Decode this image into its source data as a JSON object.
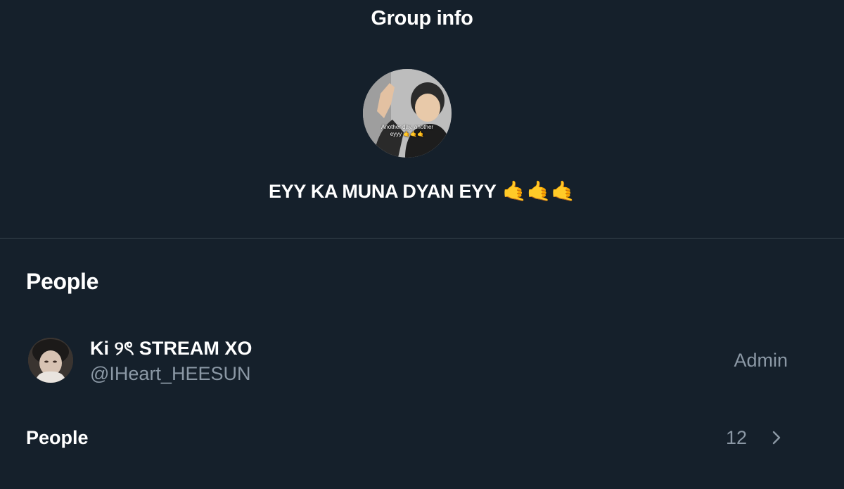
{
  "header": {
    "title": "Group info"
  },
  "group": {
    "avatar_caption_line1": "Another day, another",
    "avatar_caption_line2": "eyyy 🤙🤙🤙",
    "name": "EYY KA MUNA DYAN EYY",
    "name_emoji": "🤙🤙🤙"
  },
  "people_section": {
    "heading": "People",
    "members": [
      {
        "name": "Ki ୨ৎ STREAM XO",
        "handle": "@IHeart_HEESUN",
        "role": "Admin"
      }
    ],
    "all_people_label": "People",
    "all_people_count": "12"
  },
  "colors": {
    "background": "#15202b",
    "divider": "#38444d",
    "secondary_text": "#8b98a5",
    "primary_text": "#ffffff"
  },
  "icons": {
    "chevron": "chevron-right-icon"
  }
}
